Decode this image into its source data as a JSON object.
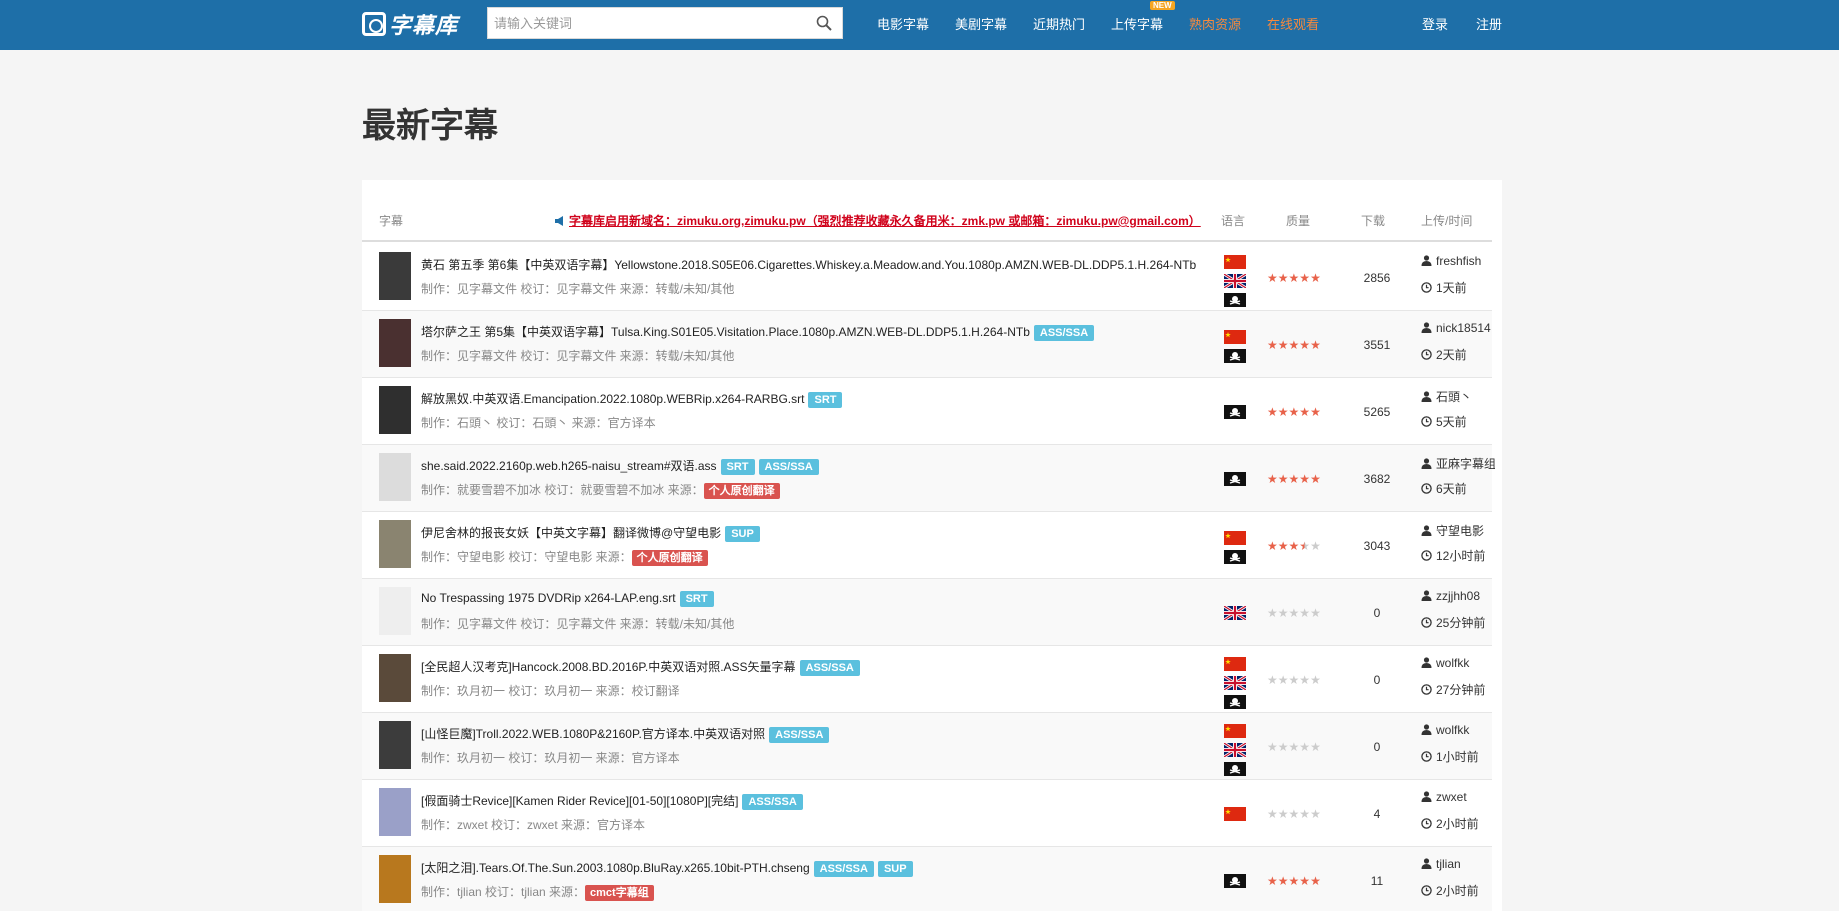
{
  "header": {
    "logo": "字幕库",
    "search_placeholder": "请输入关键词",
    "nav": [
      {
        "label": "电影字幕"
      },
      {
        "label": "美剧字幕"
      },
      {
        "label": "近期热门"
      },
      {
        "label": "上传字幕",
        "badge": "NEW"
      },
      {
        "label": "熟肉资源"
      },
      {
        "label": "在线观看"
      }
    ],
    "login": "登录",
    "register": "注册"
  },
  "page_title": "最新字幕",
  "table": {
    "col_subtitle": "字幕",
    "notice": "字幕库启用新域名：zimuku.org,zimuku.pw（强烈推荐收藏永久备用米：zmk.pw 或邮箱：zimuku.pw@gmail.com）",
    "col_lang": "语言",
    "col_quality": "质量",
    "col_downloads": "下载",
    "col_upload": "上传/时间"
  },
  "rows": [
    {
      "title": "黄石 第五季 第6集【中英双语字幕】Yellowstone.2018.S05E06.Cigarettes.Whiskey.a.Meadow.and.You.1080p.AMZN.WEB-DL.DDP5.1.H.264-NTb",
      "tags": [],
      "meta": "制作：见字幕文件 校订：见字幕文件 来源：转载/未知/其他",
      "src_tag": "",
      "flags": [
        "cn",
        "uk",
        "pirate"
      ],
      "stars": 5,
      "downloads": "2856",
      "uploader": "freshfish",
      "time": "1天前",
      "thumb": "#3a3a3a"
    },
    {
      "title": "塔尔萨之王 第5集【中英双语字幕】Tulsa.King.S01E05.Visitation.Place.1080p.AMZN.WEB-DL.DDP5.1.H.264-NTb",
      "tags": [
        "ASS/SSA"
      ],
      "meta": "制作：见字幕文件 校订：见字幕文件 来源：转载/未知/其他",
      "src_tag": "",
      "flags": [
        "cn",
        "pirate"
      ],
      "stars": 5,
      "downloads": "3551",
      "uploader": "nick18514",
      "time": "2天前",
      "thumb": "#4a3030"
    },
    {
      "title": "解放黑奴.中英双语.Emancipation.2022.1080p.WEBRip.x264-RARBG.srt",
      "tags": [
        "SRT"
      ],
      "meta": "制作：石頭丶 校订：石頭丶 来源：官方译本",
      "src_tag": "",
      "flags": [
        "pirate"
      ],
      "stars": 5,
      "downloads": "5265",
      "uploader": "石頭丶",
      "time": "5天前",
      "thumb": "#2f2f2f"
    },
    {
      "title": "she.said.2022.2160p.web.h265-naisu_stream#双语.ass",
      "tags": [
        "SRT",
        "ASS/SSA"
      ],
      "meta": "制作：就要雪碧不加冰 校订：就要雪碧不加冰 来源：",
      "src_tag": "个人原创翻译",
      "flags": [
        "pirate"
      ],
      "stars": 5,
      "downloads": "3682",
      "uploader": "亚麻字幕组",
      "time": "6天前",
      "thumb": "#dcdcdc"
    },
    {
      "title": "伊尼舍林的报丧女妖【中英文字幕】翻译微博@守望电影",
      "tags": [
        "SUP"
      ],
      "meta": "制作：守望电影 校订：守望电影 来源：",
      "src_tag": "个人原创翻译",
      "flags": [
        "cn",
        "pirate"
      ],
      "stars": 3.5,
      "downloads": "3043",
      "uploader": "守望电影",
      "time": "12小时前",
      "thumb": "#8a8470"
    },
    {
      "title": "No Trespassing 1975 DVDRip x264-LAP.eng.srt",
      "tags": [
        "SRT"
      ],
      "meta": "制作：见字幕文件 校订：见字幕文件 来源：转载/未知/其他",
      "src_tag": "",
      "flags": [
        "uk"
      ],
      "stars": 0,
      "downloads": "0",
      "uploader": "zzjjhh08",
      "time": "25分钟前",
      "thumb": "#eeeeee"
    },
    {
      "title": "[全民超人汉考克]Hancock.2008.BD.2016P.中英双语对照.ASS矢量字幕",
      "tags": [
        "ASS/SSA"
      ],
      "meta": "制作：玖月初一 校订：玖月初一 来源：校订翻译",
      "src_tag": "",
      "flags": [
        "cn",
        "uk",
        "pirate"
      ],
      "stars": 0,
      "downloads": "0",
      "uploader": "wolfkk",
      "time": "27分钟前",
      "thumb": "#5a4a3a"
    },
    {
      "title": "[山怪巨魔]Troll.2022.WEB.1080P&2160P.官方译本.中英双语对照",
      "tags": [
        "ASS/SSA"
      ],
      "meta": "制作：玖月初一 校订：玖月初一 来源：官方译本",
      "src_tag": "",
      "flags": [
        "cn",
        "uk",
        "pirate"
      ],
      "stars": 0,
      "downloads": "0",
      "uploader": "wolfkk",
      "time": "1小时前",
      "thumb": "#3c3c3c"
    },
    {
      "title": "[假面骑士Revice][Kamen Rider Revice][01-50][1080P][完结]",
      "tags": [
        "ASS/SSA"
      ],
      "meta": "制作：zwxet 校订：zwxet 来源：官方译本",
      "src_tag": "",
      "flags": [
        "cn"
      ],
      "stars": 0,
      "downloads": "4",
      "uploader": "zwxet",
      "time": "2小时前",
      "thumb": "#9aa0c8"
    },
    {
      "title": "[太阳之泪].Tears.Of.The.Sun.2003.1080p.BluRay.x265.10bit-PTH.chseng",
      "tags": [
        "ASS/SSA",
        "SUP"
      ],
      "meta": "制作：tjlian 校订：tjlian 来源：",
      "src_tag": "cmct字幕组",
      "flags": [
        "pirate"
      ],
      "stars": 5,
      "downloads": "11",
      "uploader": "tjlian",
      "time": "2小时前",
      "thumb": "#b8781e"
    }
  ],
  "colors": {
    "header_bg": "#1e6fa8",
    "tag_blue": "#5bc0de",
    "tag_red": "#d9534f",
    "star": "#e8624a",
    "star_empty": "#cccccc",
    "notice": "#d0021b"
  }
}
